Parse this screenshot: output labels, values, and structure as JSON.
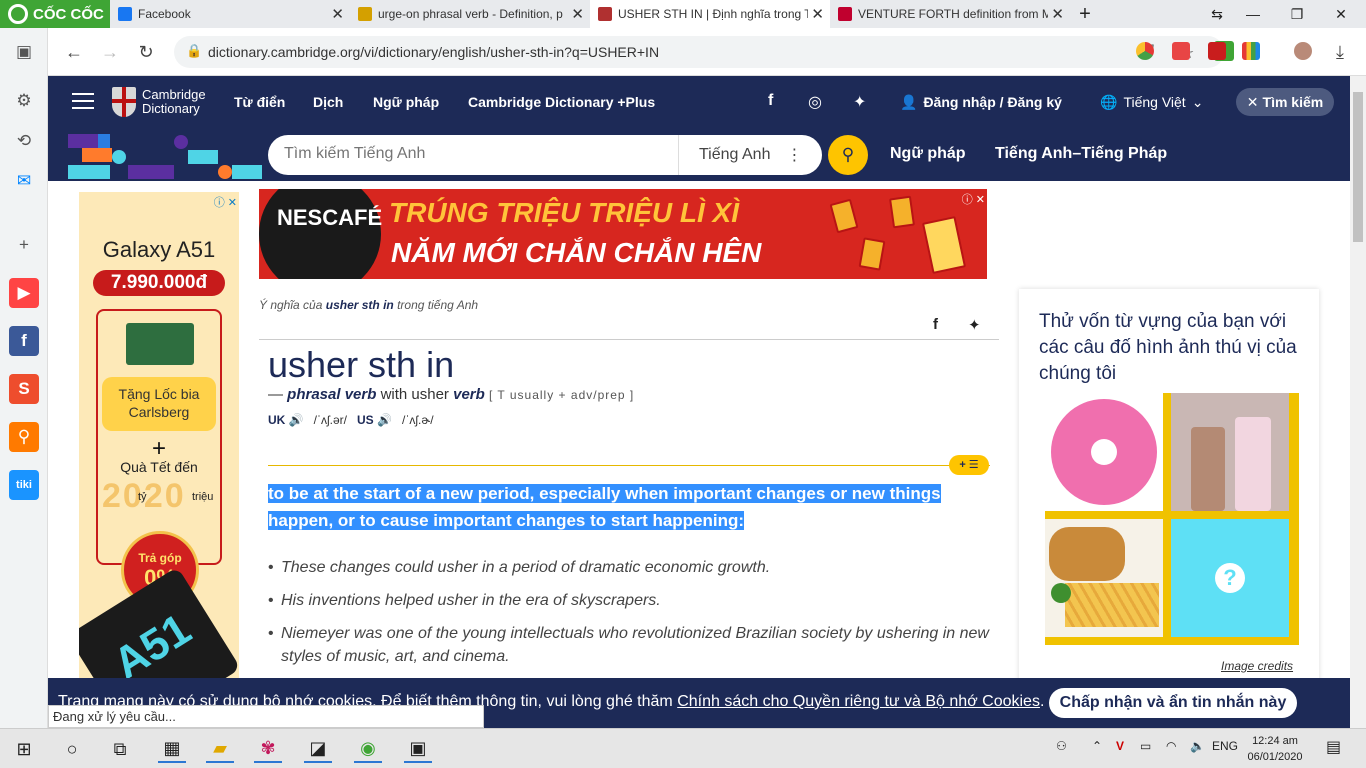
{
  "browser": {
    "brand": "CỐC CỐC",
    "tabs": [
      {
        "title": "Facebook",
        "color": "#1877f2",
        "active": false
      },
      {
        "title": "urge-on phrasal verb - Definition, p",
        "color": "#d4a000",
        "active": false
      },
      {
        "title": "USHER STH IN | Định nghĩa trong T",
        "color": "#b03030",
        "active": true
      },
      {
        "title": "VENTURE FORTH definition from M",
        "color": "#c0002e",
        "active": false
      }
    ],
    "new_tab": "+",
    "url": "dictionary.cambridge.org/vi/dictionary/english/usher-sth-in?q=USHER+IN",
    "status_text": "Đang xử lý yêu cầu..."
  },
  "site": {
    "logo_line1": "Cambridge",
    "logo_line2": "Dictionary",
    "menu": [
      "Từ điển",
      "Dịch",
      "Ngữ pháp",
      "Cambridge Dictionary +Plus"
    ],
    "login": "Đăng nhập / Đăng ký",
    "language": "Tiếng Việt",
    "search_toggle": "Tìm kiếm",
    "search_placeholder": "Tìm kiếm Tiếng Anh",
    "dictionary_select": "Tiếng Anh",
    "search_links": [
      "Ngữ pháp",
      "Tiếng Anh–Tiếng Pháp"
    ]
  },
  "ads": {
    "left": {
      "title": "Galaxy A51",
      "price": "7.990.000đ",
      "gift": "Tặng Lốc bia Carlsberg",
      "plus": "+",
      "qua": "Quà Tết đến",
      "year": "2020",
      "ty": "tỷ",
      "trieu": "triệu",
      "installment": "Trả góp",
      "installment_rate": "0%",
      "phone_model": "A51"
    },
    "banner": {
      "brand": "NESCAFÉ",
      "line1": "TRÚNG TRIỆU TRIỆU LÌ XÌ",
      "line2": "NĂM MỚI CHẮN CHẮN HÊN"
    }
  },
  "entry": {
    "breadcrumb_prefix": "Ý nghĩa của",
    "breadcrumb_word": "usher sth in",
    "breadcrumb_suffix": "trong tiếng Anh",
    "headword": "usher sth in",
    "pos_dash": "—",
    "pos_phrasal": "phrasal verb",
    "pos_with": "with usher",
    "pos_verb": "verb",
    "grammar": "[ T usually + adv/prep ]",
    "uk_label": "UK",
    "uk_ipa": "/ˈʌʃ.ər/",
    "us_label": "US",
    "us_ipa": "/ˈʌʃ.ɚ/",
    "plus_button": "+ ☰",
    "definition": "to be at the start of a new period, especially when important changes or new things happen, or to cause important changes to start happening:",
    "examples": [
      "These changes could usher in a period of dramatic economic growth.",
      "His inventions helped usher in the era of skyscrapers.",
      "Niemeyer was one of the young intellectuals who revolutionized Brazilian society by ushering in new styles of music, art, and cinema."
    ]
  },
  "quiz": {
    "title": "Thử vốn từ vựng của bạn với các câu đố hình ảnh thú vị của chúng tôi",
    "unknown": "?",
    "credits": "Image credits"
  },
  "cookie": {
    "text": "Trang mạng này có sử dụng bộ nhớ cookies. Để biết thêm thông tin, vui lòng ghé thăm",
    "link": "Chính sách cho Quyền riêng tư và Bộ nhớ Cookies",
    "period": ".",
    "accept": "Chấp nhận và ẩn tin nhắn này"
  },
  "taskbar": {
    "lang": "ENG",
    "time": "12:24 am",
    "date": "06/01/2020"
  }
}
